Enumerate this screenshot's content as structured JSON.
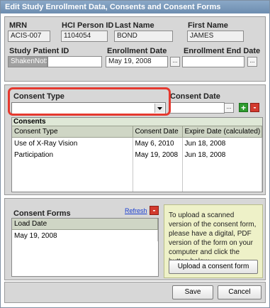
{
  "window": {
    "title": "Edit Study Enrollment Data, Consents and Consent Forms"
  },
  "patient": {
    "mrn_label": "MRN",
    "mrn": "ACIS-007",
    "hci_label": "HCI Person ID",
    "hci": "1104054",
    "last_label": "Last Name",
    "last": "BOND",
    "first_label": "First Name",
    "first": "JAMES",
    "study_label": "Study Patient ID",
    "study_id": "ShakenNotStirred",
    "enroll_label": "Enrollment Date",
    "enroll_date": "May 19, 2008",
    "end_label": "Enrollment End Date",
    "end_date": ""
  },
  "consent_entry": {
    "type_label": "Consent Type",
    "type_value": "",
    "date_label": "Consent Date",
    "date_value": ""
  },
  "consents": {
    "header": "Consents",
    "columns": [
      "Consent Type",
      "Consent Date",
      "Expire Date (calculated)"
    ],
    "rows": [
      [
        "Use of X-Ray Vision",
        "May 6, 2010",
        "Jun 18, 2008"
      ],
      [
        "Participation",
        "May 19, 2008",
        "Jun 18, 2008"
      ]
    ]
  },
  "forms": {
    "header": "Consent Forms",
    "refresh_label": "Refresh",
    "columns": [
      "Load Date"
    ],
    "rows": [
      [
        "May 19, 2008"
      ]
    ],
    "info_text": "To upload a scanned version of the consent form, please have a digital, PDF version of the form on your computer and click the button below.",
    "upload_label": "Upload a consent form"
  },
  "footer": {
    "save_label": "Save",
    "cancel_label": "Cancel"
  },
  "icons": {
    "plus": "+",
    "minus": "-",
    "calendar": "...",
    "remove": "-"
  }
}
